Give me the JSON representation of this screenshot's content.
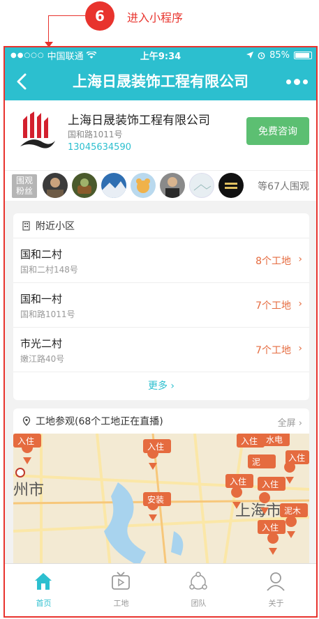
{
  "annotation": {
    "step": "6",
    "label": "进入小程序",
    "color": "#e8332d"
  },
  "status_bar": {
    "carrier": "中国联通",
    "time": "上午9:34",
    "battery": "85%"
  },
  "nav": {
    "title": "上海日晟装饰工程有限公司",
    "back_icon": "chevron-left-icon",
    "more_icon": "more-dots-icon"
  },
  "company": {
    "name": "上海日晟装饰工程有限公司",
    "address": "国和路1011号",
    "phone": "13045634590",
    "consult_label": "免费咨询"
  },
  "followers": {
    "tag_line1": "围观",
    "tag_line2": "粉丝",
    "count_text": "等67人围观"
  },
  "nearby": {
    "title": "附近小区",
    "items": [
      {
        "name": "国和二村",
        "address": "国和二村148号",
        "count": "8个工地"
      },
      {
        "name": "国和一村",
        "address": "国和路1011号",
        "count": "7个工地"
      },
      {
        "name": "市光二村",
        "address": "嫩江路40号",
        "count": "7个工地"
      }
    ],
    "more_label": "更多"
  },
  "sites": {
    "title": "工地参观(68个工地正在直播)",
    "fullscreen_label": "全屏",
    "map_labels": {
      "city_left": "州市",
      "city_right": "上海市"
    },
    "pins": [
      "入住",
      "入住",
      "入住",
      "水电",
      "泥",
      "入住",
      "入住",
      "安装",
      "入住",
      "泥木",
      "入住"
    ]
  },
  "tabs": [
    {
      "label": "首页",
      "icon": "home-icon",
      "active": true
    },
    {
      "label": "工地",
      "icon": "tv-icon",
      "active": false
    },
    {
      "label": "团队",
      "icon": "team-icon",
      "active": false
    },
    {
      "label": "关于",
      "icon": "user-icon",
      "active": false
    }
  ],
  "colors": {
    "brand": "#2cbfcf",
    "accent": "#e56b3f",
    "consult": "#5cbf72"
  }
}
